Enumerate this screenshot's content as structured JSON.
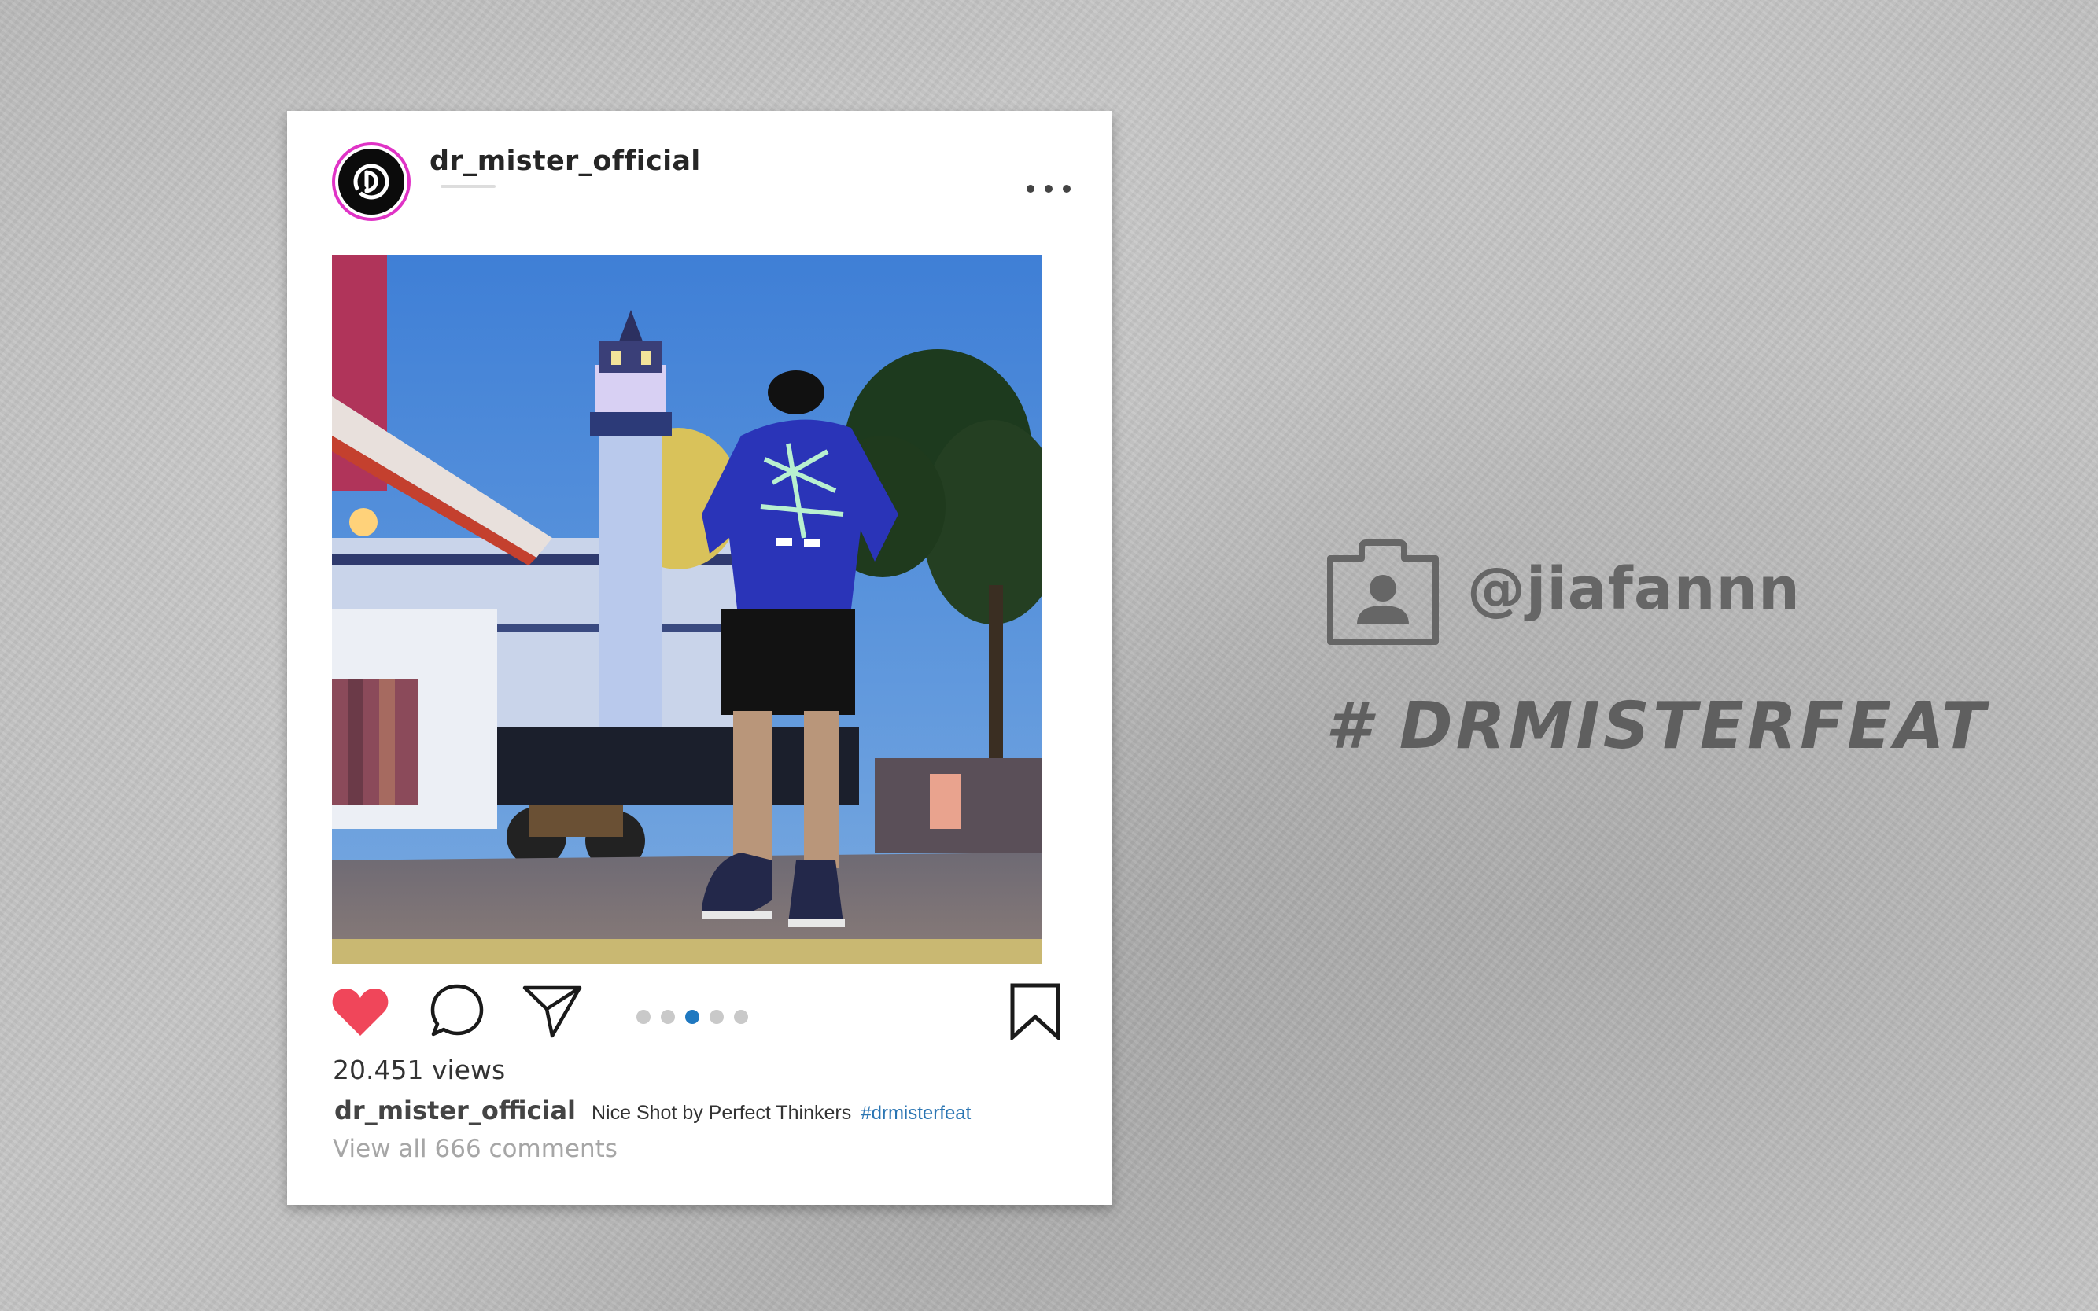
{
  "post": {
    "username": "dr_mister_official",
    "views": "20.451 views",
    "caption_user": "dr_mister_official",
    "caption_text": "Nice Shot by Perfect Thinkers",
    "caption_hashtag": "#drmisterfeat",
    "view_all_comments": "View all 666 comments",
    "carousel": {
      "count": 5,
      "active_index": 2
    }
  },
  "side": {
    "handle": "@jiafannn",
    "hashtag": "# DRMISTERFEAT"
  },
  "icons": {
    "like": "heart-icon",
    "comment": "comment-icon",
    "share": "send-icon",
    "save": "bookmark-icon",
    "more": "more-icon",
    "profile": "profile-icon"
  },
  "colors": {
    "like": "#f0465a",
    "avatar_ring": "#e033c6",
    "carousel_active": "#1f78c0",
    "hashtag_link": "#2a75b3",
    "side_text": "#666666"
  }
}
